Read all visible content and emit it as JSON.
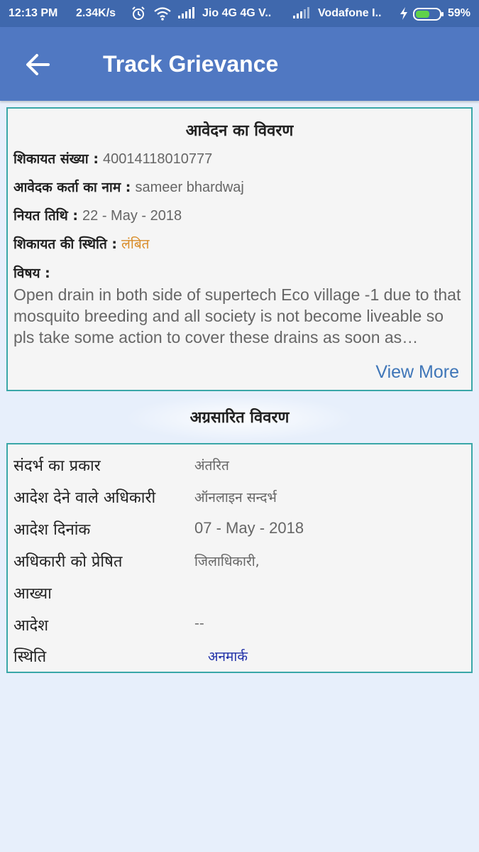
{
  "status_bar": {
    "time": "12:13 PM",
    "speed": "2.34K/s",
    "carrier1": "Jio 4G 4G  V..",
    "carrier2": "Vodafone I..",
    "battery": "59%",
    "battery_level": 0.59,
    "icons": [
      "alarm-icon",
      "wifi-icon",
      "signal-icon",
      "signal-icon",
      "charging-icon",
      "battery-icon"
    ]
  },
  "app_bar": {
    "title": "Track Grievance",
    "back_icon": "arrow-left-icon"
  },
  "application": {
    "heading": "आवेदन का विवरण",
    "complaint_no_label": "शिकायत संख्या :",
    "complaint_no": "40014118010777",
    "applicant_label": "आवेदक कर्ता का नाम :",
    "applicant": "sameer bhardwaj",
    "due_date_label": "नियत तिथि :",
    "due_date": "22 - May - 2018",
    "status_label": "शिकायत की स्थिति :",
    "status": "लंबित",
    "subject_label": "विषय :",
    "subject": "Open drain in both side of supertech Eco village -1 due to that mosquito breeding and all society is not become liveable so pls take some action to cover these drains as soon as possible",
    "view_more": "View More"
  },
  "forwarded": {
    "heading": "अग्रसारित विवरण",
    "rows": [
      {
        "label": "संदर्भ का प्रकार",
        "value": "अंतरित"
      },
      {
        "label": "आदेश देने वाले अधिकारी",
        "value": "ऑनलाइन सन्दर्भ"
      },
      {
        "label": "आदेश दिनांक",
        "value": "07 - May - 2018"
      },
      {
        "label": "अधिकारी को प्रेषित",
        "value": "जिलाधिकारी,"
      },
      {
        "label": "आख्या",
        "value": ""
      },
      {
        "label": "आदेश",
        "value": "--"
      },
      {
        "label": "स्थिति",
        "value": "अनमार्क"
      }
    ]
  },
  "colors": {
    "status_bar": "#3f68ad",
    "app_bar": "#5078c2",
    "card_border": "#3aa7a8",
    "status_pending": "#d98c28",
    "link": "#3f76b8",
    "unmarked": "#1f2fa8"
  }
}
